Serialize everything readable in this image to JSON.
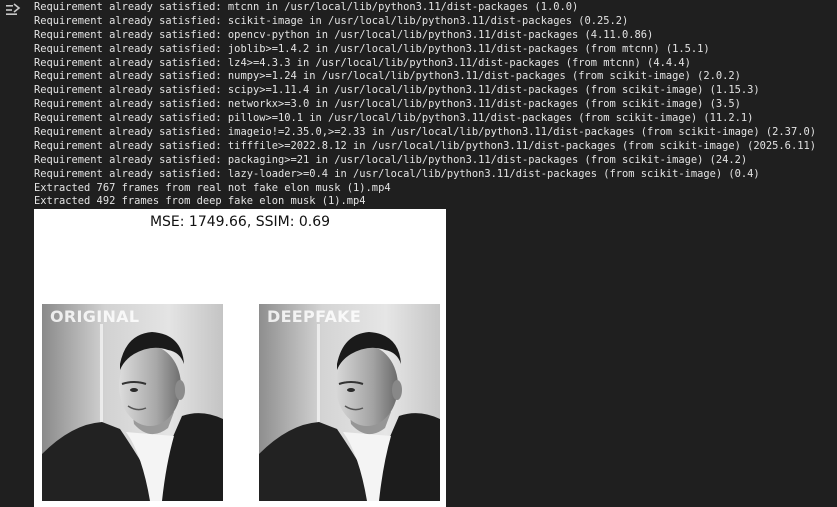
{
  "output": {
    "lines": [
      "Requirement already satisfied: mtcnn in /usr/local/lib/python3.11/dist-packages (1.0.0)",
      "Requirement already satisfied: scikit-image in /usr/local/lib/python3.11/dist-packages (0.25.2)",
      "Requirement already satisfied: opencv-python in /usr/local/lib/python3.11/dist-packages (4.11.0.86)",
      "Requirement already satisfied: joblib>=1.4.2 in /usr/local/lib/python3.11/dist-packages (from mtcnn) (1.5.1)",
      "Requirement already satisfied: lz4>=4.3.3 in /usr/local/lib/python3.11/dist-packages (from mtcnn) (4.4.4)",
      "Requirement already satisfied: numpy>=1.24 in /usr/local/lib/python3.11/dist-packages (from scikit-image) (2.0.2)",
      "Requirement already satisfied: scipy>=1.11.4 in /usr/local/lib/python3.11/dist-packages (from scikit-image) (1.15.3)",
      "Requirement already satisfied: networkx>=3.0 in /usr/local/lib/python3.11/dist-packages (from scikit-image) (3.5)",
      "Requirement already satisfied: pillow>=10.1 in /usr/local/lib/python3.11/dist-packages (from scikit-image) (11.2.1)",
      "Requirement already satisfied: imageio!=2.35.0,>=2.33 in /usr/local/lib/python3.11/dist-packages (from scikit-image) (2.37.0)",
      "Requirement already satisfied: tifffile>=2022.8.12 in /usr/local/lib/python3.11/dist-packages (from scikit-image) (2025.6.11)",
      "Requirement already satisfied: packaging>=21 in /usr/local/lib/python3.11/dist-packages (from scikit-image) (24.2)",
      "Requirement already satisfied: lazy-loader>=0.4 in /usr/local/lib/python3.11/dist-packages (from scikit-image) (0.4)",
      "Extracted 767 frames from real not fake elon musk (1).mp4",
      "Extracted 492 frames from deep fake elon musk (1).mp4"
    ]
  },
  "figure": {
    "title": "MSE: 1749.66, SSIM: 0.69",
    "left_label": "ORIGINAL",
    "right_label": "DEEPFAKE"
  },
  "icons": {
    "gutter": "output-toggle-icon"
  },
  "colors": {
    "background": "#1f1f1f",
    "text": "#e3e3e3",
    "figure_bg": "#ffffff"
  }
}
